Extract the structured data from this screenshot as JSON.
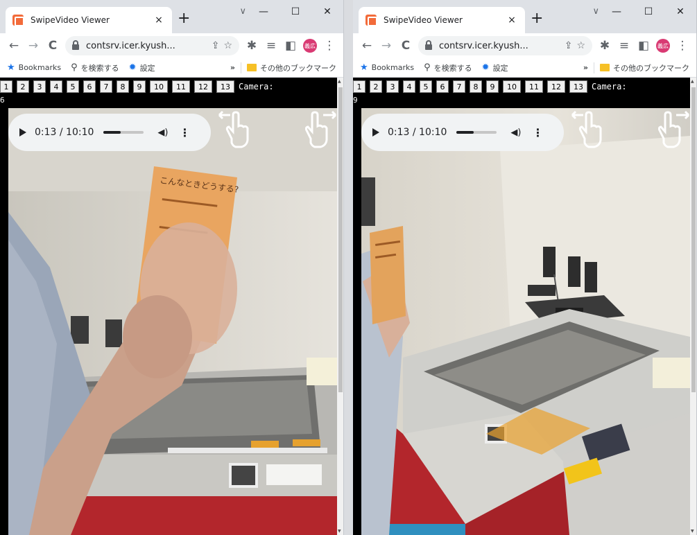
{
  "windows": [
    {
      "tab_title": "SwipeVideo Viewer",
      "url": "contsrv.icer.kyush...",
      "camera_label": "Camera:",
      "camera_value": "6",
      "player": {
        "time": "0:13 / 10:10",
        "progress": 0.021,
        "volume": 1.0
      },
      "scene": "hand"
    },
    {
      "tab_title": "SwipeVideo Viewer",
      "url": "contsrv.icer.kyush...",
      "camera_label": "Camera:",
      "camera_value": "9",
      "player": {
        "time": "0:13 / 10:10",
        "progress": 0.021,
        "volume": 1.0
      },
      "scene": "machine"
    }
  ],
  "new_tab": "+",
  "tab_close": "×",
  "window_controls": {
    "search": "∨",
    "minimize": "—",
    "maximize": "☐",
    "close": "✕"
  },
  "toolbar": {
    "back": "←",
    "forward": "→",
    "reload": "C",
    "avatar_text": "義広"
  },
  "bookmarks": {
    "bookmarks_label": "Bookmarks",
    "search_label": "を検索する",
    "settings_label": "設定",
    "overflow": "»",
    "other_label": "その他のブックマーク"
  },
  "camera_buttons": [
    "1",
    "2",
    "3",
    "4",
    "5",
    "6",
    "7",
    "8",
    "9",
    "10",
    "11",
    "12",
    "13"
  ],
  "card_text": {
    "heading": "こんなときどうする?"
  },
  "colors": {
    "accent": "#1a73e8",
    "favicon": "#f26b3a",
    "avatar": "#d93a73",
    "folder": "#f6c026",
    "machine_red": "#b3262c"
  }
}
